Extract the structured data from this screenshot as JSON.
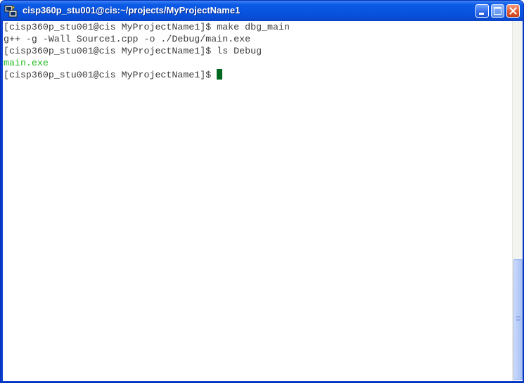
{
  "window": {
    "title": "cisp360p_stu001@cis:~/projects/MyProjectName1",
    "icon": "putty-terminal-icon",
    "buttons": {
      "minimize": "minimize-icon",
      "maximize": "maximize-icon",
      "close": "close-icon"
    }
  },
  "terminal": {
    "lines": [
      "[cisp360p_stu001@cis MyProjectName1]$ make dbg_main",
      "g++ -g -Wall Source1.cpp -o ./Debug/main.exe",
      "[cisp360p_stu001@cis MyProjectName1]$ ls Debug",
      "main.exe",
      "[cisp360p_stu001@cis MyProjectName1]$ "
    ],
    "executable_color": "#22bb22",
    "text_color": "#3a3a3a",
    "cursor_color": "#00681f"
  },
  "scrollbar": {
    "position_fraction": 1.0
  }
}
